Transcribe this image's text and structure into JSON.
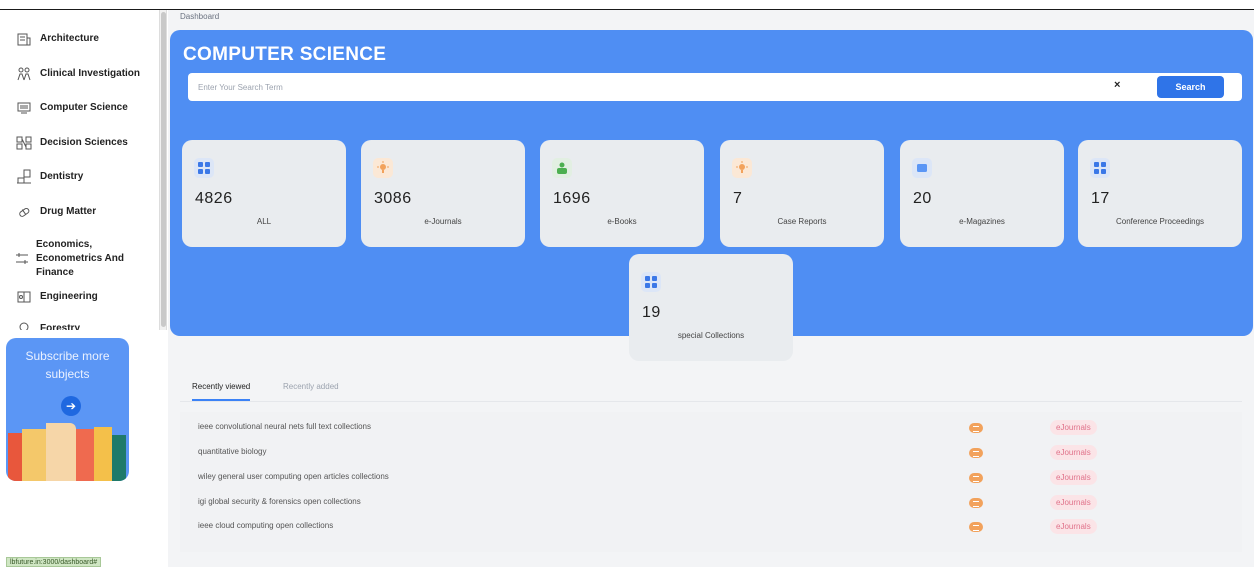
{
  "sidebar": {
    "subjects": [
      {
        "label": "Architecture",
        "icon": "building-icon"
      },
      {
        "label": "Clinical Investigation",
        "icon": "medical-team-icon"
      },
      {
        "label": "Computer Science",
        "icon": "monitor-icon"
      },
      {
        "label": "Decision Sciences",
        "icon": "decision-network-icon"
      },
      {
        "label": "Dentistry",
        "icon": "dental-chair-icon"
      },
      {
        "label": "Drug Matter",
        "icon": "pill-icon"
      },
      {
        "label": "Economics, Econometrics And Finance",
        "icon": "finance-chart-icon"
      },
      {
        "label": "Engineering",
        "icon": "gear-book-icon"
      },
      {
        "label": "Forestry",
        "icon": "tree-icon"
      }
    ],
    "promo": {
      "text": "Subscribe more subjects"
    },
    "status_url": "lbfuture.in:3000/dashboard#"
  },
  "breadcrumb": "Dashboard",
  "hero": {
    "title": "COMPUTER SCIENCE",
    "search_placeholder": "Enter Your Search Term",
    "clear_label": "×",
    "search_button": "Search"
  },
  "cards": [
    {
      "count": "4826",
      "label": "ALL",
      "icon": "grid-icon"
    },
    {
      "count": "3086",
      "label": "e-Journals",
      "icon": "lightbulb-icon"
    },
    {
      "count": "1696",
      "label": "e-Books",
      "icon": "reader-icon"
    },
    {
      "count": "7",
      "label": "Case Reports",
      "icon": "lightbulb-icon"
    },
    {
      "count": "20",
      "label": "e-Magazines",
      "icon": "magazine-icon"
    },
    {
      "count": "17",
      "label": "Conference Proceedings",
      "icon": "grid-icon"
    },
    {
      "count": "19",
      "label": "special Collections",
      "icon": "grid-icon"
    }
  ],
  "tabs": [
    "Recently viewed",
    "Recently added"
  ],
  "recent": [
    {
      "title": "ieee convolutional neural nets full text collections",
      "badge": "eJournals"
    },
    {
      "title": "quantitative biology",
      "badge": "eJournals"
    },
    {
      "title": "wiley general user computing open articles collections",
      "badge": "eJournals"
    },
    {
      "title": "igi global security & forensics open collections",
      "badge": "eJournals"
    },
    {
      "title": "ieee cloud computing open collections",
      "badge": "eJournals"
    }
  ],
  "colors": {
    "hero": "#4f8ef3",
    "button": "#2f74e8",
    "badge_bg": "#fbe4e7",
    "badge_text": "#e0728a",
    "icon_orange": "#f2a25c"
  }
}
